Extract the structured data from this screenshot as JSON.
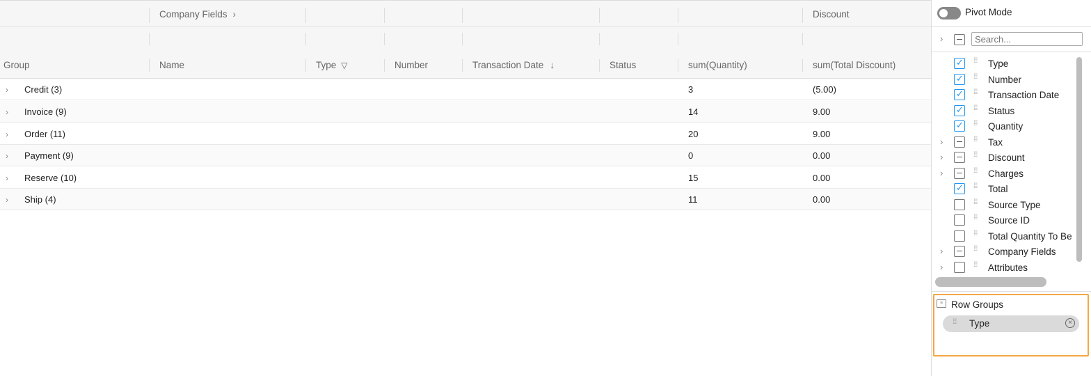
{
  "header_groups": {
    "company_fields": "Company Fields",
    "discount": "Discount"
  },
  "columns": [
    "Group",
    "Name",
    "Type",
    "Number",
    "Transaction Date",
    "Status",
    "sum(Quantity)",
    "sum(Total Discount)"
  ],
  "rows": [
    {
      "group": "Credit (3)",
      "quantity": "3",
      "discount": "(5.00)"
    },
    {
      "group": "Invoice (9)",
      "quantity": "14",
      "discount": "9.00"
    },
    {
      "group": "Order (11)",
      "quantity": "20",
      "discount": "9.00"
    },
    {
      "group": "Payment (9)",
      "quantity": "0",
      "discount": "0.00"
    },
    {
      "group": "Reserve (10)",
      "quantity": "15",
      "discount": "0.00"
    },
    {
      "group": "Ship (4)",
      "quantity": "11",
      "discount": "0.00"
    }
  ],
  "side_panel": {
    "pivot_mode_label": "Pivot Mode",
    "search_placeholder": "Search...",
    "columns_list": [
      {
        "label": "Type",
        "state": "checked"
      },
      {
        "label": "Number",
        "state": "checked"
      },
      {
        "label": "Transaction Date",
        "state": "checked"
      },
      {
        "label": "Status",
        "state": "checked"
      },
      {
        "label": "Quantity",
        "state": "checked"
      },
      {
        "label": "Tax",
        "state": "partial"
      },
      {
        "label": "Discount",
        "state": "partial"
      },
      {
        "label": "Charges",
        "state": "partial"
      },
      {
        "label": "Total",
        "state": "checked"
      },
      {
        "label": "Source Type",
        "state": "unchecked"
      },
      {
        "label": "Source ID",
        "state": "unchecked"
      },
      {
        "label": "Total Quantity To Be",
        "state": "unchecked"
      },
      {
        "label": "Company Fields",
        "state": "partial"
      },
      {
        "label": "Attributes",
        "state": "unchecked"
      }
    ],
    "row_groups_title": "Row Groups",
    "row_group_chip": "Type"
  },
  "colors": {
    "accent": "#2196f3",
    "highlight_border": "#f5a742"
  }
}
